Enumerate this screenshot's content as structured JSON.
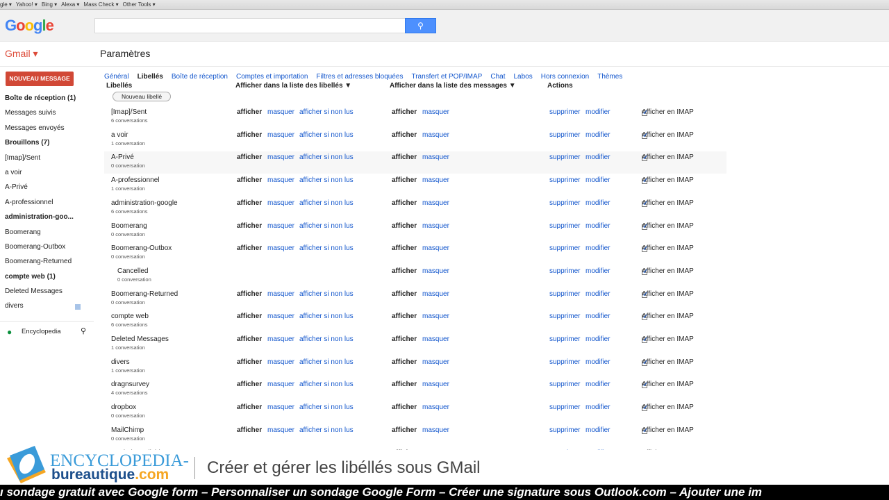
{
  "bookmarks": [
    "gle ▾",
    "Yahoo! ▾",
    "Bing ▾",
    "Alexa ▾",
    "Mass Check ▾",
    "Other Tools ▾"
  ],
  "header": {
    "logo": "Google",
    "search_placeholder": "",
    "search_icon": "🔍"
  },
  "gmail_label": "Gmail ▾",
  "page_title": "Paramètres",
  "compose": "NOUVEAU MESSAGE",
  "sidebar": [
    {
      "label": "Boîte de réception (1)",
      "bold": true
    },
    {
      "label": "Messages suivis"
    },
    {
      "label": "Messages envoyés"
    },
    {
      "label": "Brouillons (7)",
      "bold": true
    },
    {
      "label": "[Imap]/Sent"
    },
    {
      "label": "a voir"
    },
    {
      "label": "A-Privé"
    },
    {
      "label": "A-professionnel"
    },
    {
      "label": "administration-goo...",
      "bold": true
    },
    {
      "label": "Boomerang"
    },
    {
      "label": "Boomerang-Outbox"
    },
    {
      "label": "Boomerang-Returned"
    },
    {
      "label": "compte web (1)",
      "bold": true
    },
    {
      "label": "Deleted Messages"
    },
    {
      "label": "divers"
    }
  ],
  "hangouts_user": "Encyclopedia",
  "tabs": [
    "Général",
    "Libellés",
    "Boîte de réception",
    "Comptes et importation",
    "Filtres et adresses bloquées",
    "Transfert et POP/IMAP",
    "Chat",
    "Labos",
    "Hors connexion",
    "Thèmes"
  ],
  "columns": {
    "labels": "Libellés",
    "label_list": "Afficher dans la liste des libellés ▼",
    "message_list": "Afficher dans la liste des messages ▼",
    "actions": "Actions"
  },
  "new_label_button": "Nouveau libellé",
  "actions": {
    "show": "afficher",
    "hide": "masquer",
    "show_unread": "afficher si non lus",
    "delete": "supprimer",
    "edit": "modifier",
    "imap": "Afficher en IMAP"
  },
  "labels": [
    {
      "name": "[Imap]/Sent",
      "count": "6 conversations"
    },
    {
      "name": "a voir",
      "count": "1 conversation"
    },
    {
      "name": "A-Privé",
      "count": "0 conversation"
    },
    {
      "name": "A-professionnel",
      "count": "1 conversation"
    },
    {
      "name": "administration-google",
      "count": "6 conversations"
    },
    {
      "name": "Boomerang",
      "count": "0 conversation"
    },
    {
      "name": "Boomerang-Outbox",
      "count": "0 conversation"
    },
    {
      "name": "Cancelled",
      "count": "0 conversation",
      "sub": true
    },
    {
      "name": "Boomerang-Returned",
      "count": "0 conversation"
    },
    {
      "name": "compte web",
      "count": "6 conversations"
    },
    {
      "name": "Deleted Messages",
      "count": "1 conversation"
    },
    {
      "name": "divers",
      "count": "1 conversation"
    },
    {
      "name": "dragnsurvey",
      "count": "4 conversations"
    },
    {
      "name": "dropbox",
      "count": "0 conversation"
    },
    {
      "name": "MailChimp",
      "count": "0 conversation"
    },
    {
      "name": "admin-mailchimp",
      "count": "",
      "sub": true
    }
  ],
  "banner": {
    "brand_top": "ENCYCLOPEDIA-",
    "brand_bottom": "bureautique",
    "brand_tld": ".com",
    "title": "Créer et gérer les libéllés sous GMail"
  },
  "ticker": "ı sondage gratuit avec Google form – Personnaliser un sondage Google Form – Créer une signature sous Outlook.com – Ajouter une im"
}
